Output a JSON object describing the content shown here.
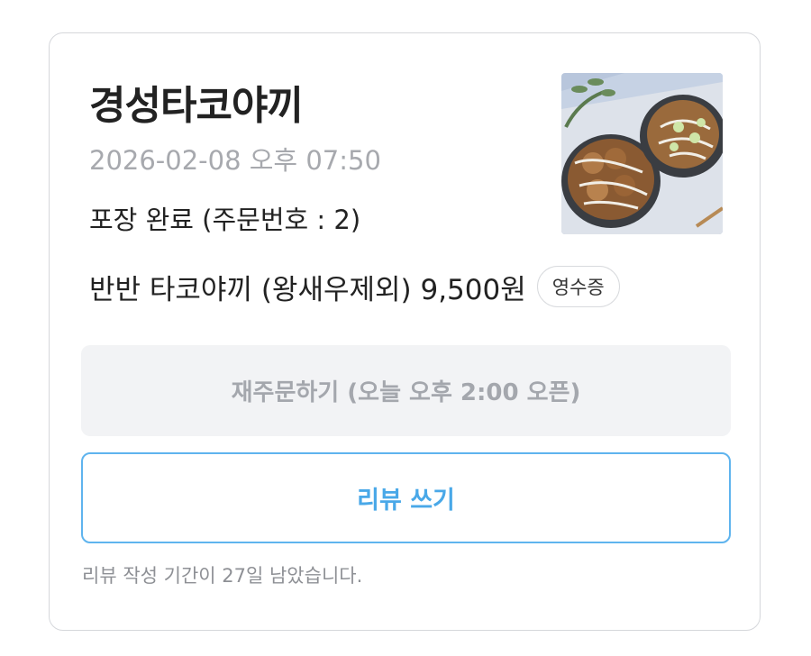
{
  "order": {
    "store_name": "경성타코야끼",
    "datetime": "2026-02-08 오후 07:50",
    "status": "포장 완료 (주문번호 : 2)",
    "menu_summary": "반반 타코야끼 (왕새우제외) 9,500원",
    "receipt_label": "영수증",
    "thumbnail_icon": "food-photo"
  },
  "actions": {
    "reorder_label": "재주문하기 (오늘 오후 2:00 오픈)",
    "review_label": "리뷰 쓰기"
  },
  "notice": "리뷰 작성 기간이 27일 남았습니다.",
  "colors": {
    "accent": "#49a8e8",
    "review_border": "#5fb4ee",
    "disabled_bg": "#f2f3f5",
    "disabled_text": "#a4a7ad",
    "muted_text": "#a7a9ae"
  }
}
